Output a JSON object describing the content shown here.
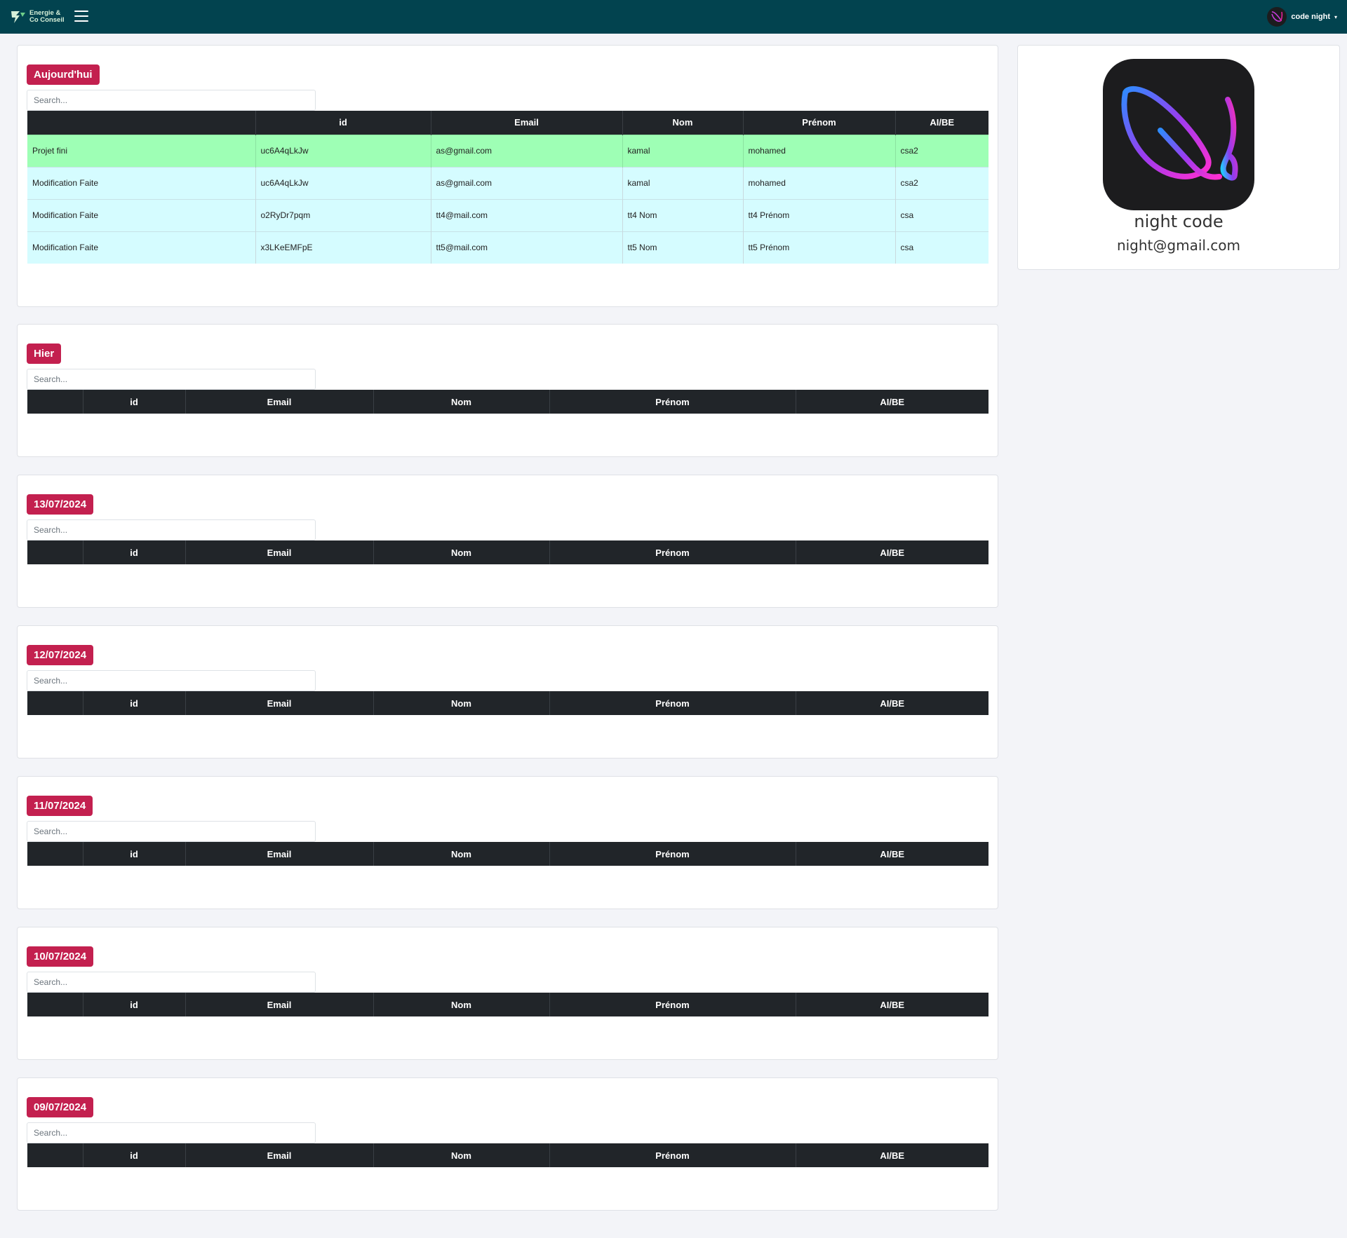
{
  "navbar": {
    "brand_line1": "Energie &",
    "brand_line2": "Co Conseil",
    "menu_icon": "hamburger-icon",
    "user_name": "code night",
    "user_caret": "▾"
  },
  "search_placeholder": "Search...",
  "days": [
    {
      "label": "Aujourd'hui",
      "columns": [
        "",
        "id",
        "Email",
        "Nom",
        "Prénom",
        "AI/BE"
      ],
      "rows": [
        {
          "status": "Projet fini",
          "id": "uc6A4qLkJw",
          "email": "as@gmail.com",
          "nom": "kamal",
          "prenom": "mohamed",
          "aibe": "csa2"
        },
        {
          "status": "Modification Faite",
          "id": "uc6A4qLkJw",
          "email": "as@gmail.com",
          "nom": "kamal",
          "prenom": "mohamed",
          "aibe": "csa2"
        },
        {
          "status": "Modification Faite",
          "id": "o2RyDr7pqm",
          "email": "tt4@mail.com",
          "nom": "tt4 Nom",
          "prenom": "tt4 Prénom",
          "aibe": "csa"
        },
        {
          "status": "Modification Faite",
          "id": "x3LKeEMFpE",
          "email": "tt5@mail.com",
          "nom": "tt5 Nom",
          "prenom": "tt5 Prénom",
          "aibe": "csa"
        }
      ]
    },
    {
      "label": "Hier",
      "columns": [
        "",
        "id",
        "Email",
        "Nom",
        "Prénom",
        "AI/BE"
      ],
      "rows": []
    },
    {
      "label": "13/07/2024",
      "columns": [
        "",
        "id",
        "Email",
        "Nom",
        "Prénom",
        "AI/BE"
      ],
      "rows": []
    },
    {
      "label": "12/07/2024",
      "columns": [
        "",
        "id",
        "Email",
        "Nom",
        "Prénom",
        "AI/BE"
      ],
      "rows": []
    },
    {
      "label": "11/07/2024",
      "columns": [
        "",
        "id",
        "Email",
        "Nom",
        "Prénom",
        "AI/BE"
      ],
      "rows": []
    },
    {
      "label": "10/07/2024",
      "columns": [
        "",
        "id",
        "Email",
        "Nom",
        "Prénom",
        "AI/BE"
      ],
      "rows": []
    },
    {
      "label": "09/07/2024",
      "columns": [
        "",
        "id",
        "Email",
        "Nom",
        "Prénom",
        "AI/BE"
      ],
      "rows": []
    }
  ],
  "profile": {
    "name": "night code",
    "email": "night@gmail.com"
  },
  "colors": {
    "navbar": "#02434f",
    "badge": "#c3204f",
    "table_header": "#212529",
    "row_done": "#9effb5",
    "row_modified": "#d5fcff"
  }
}
